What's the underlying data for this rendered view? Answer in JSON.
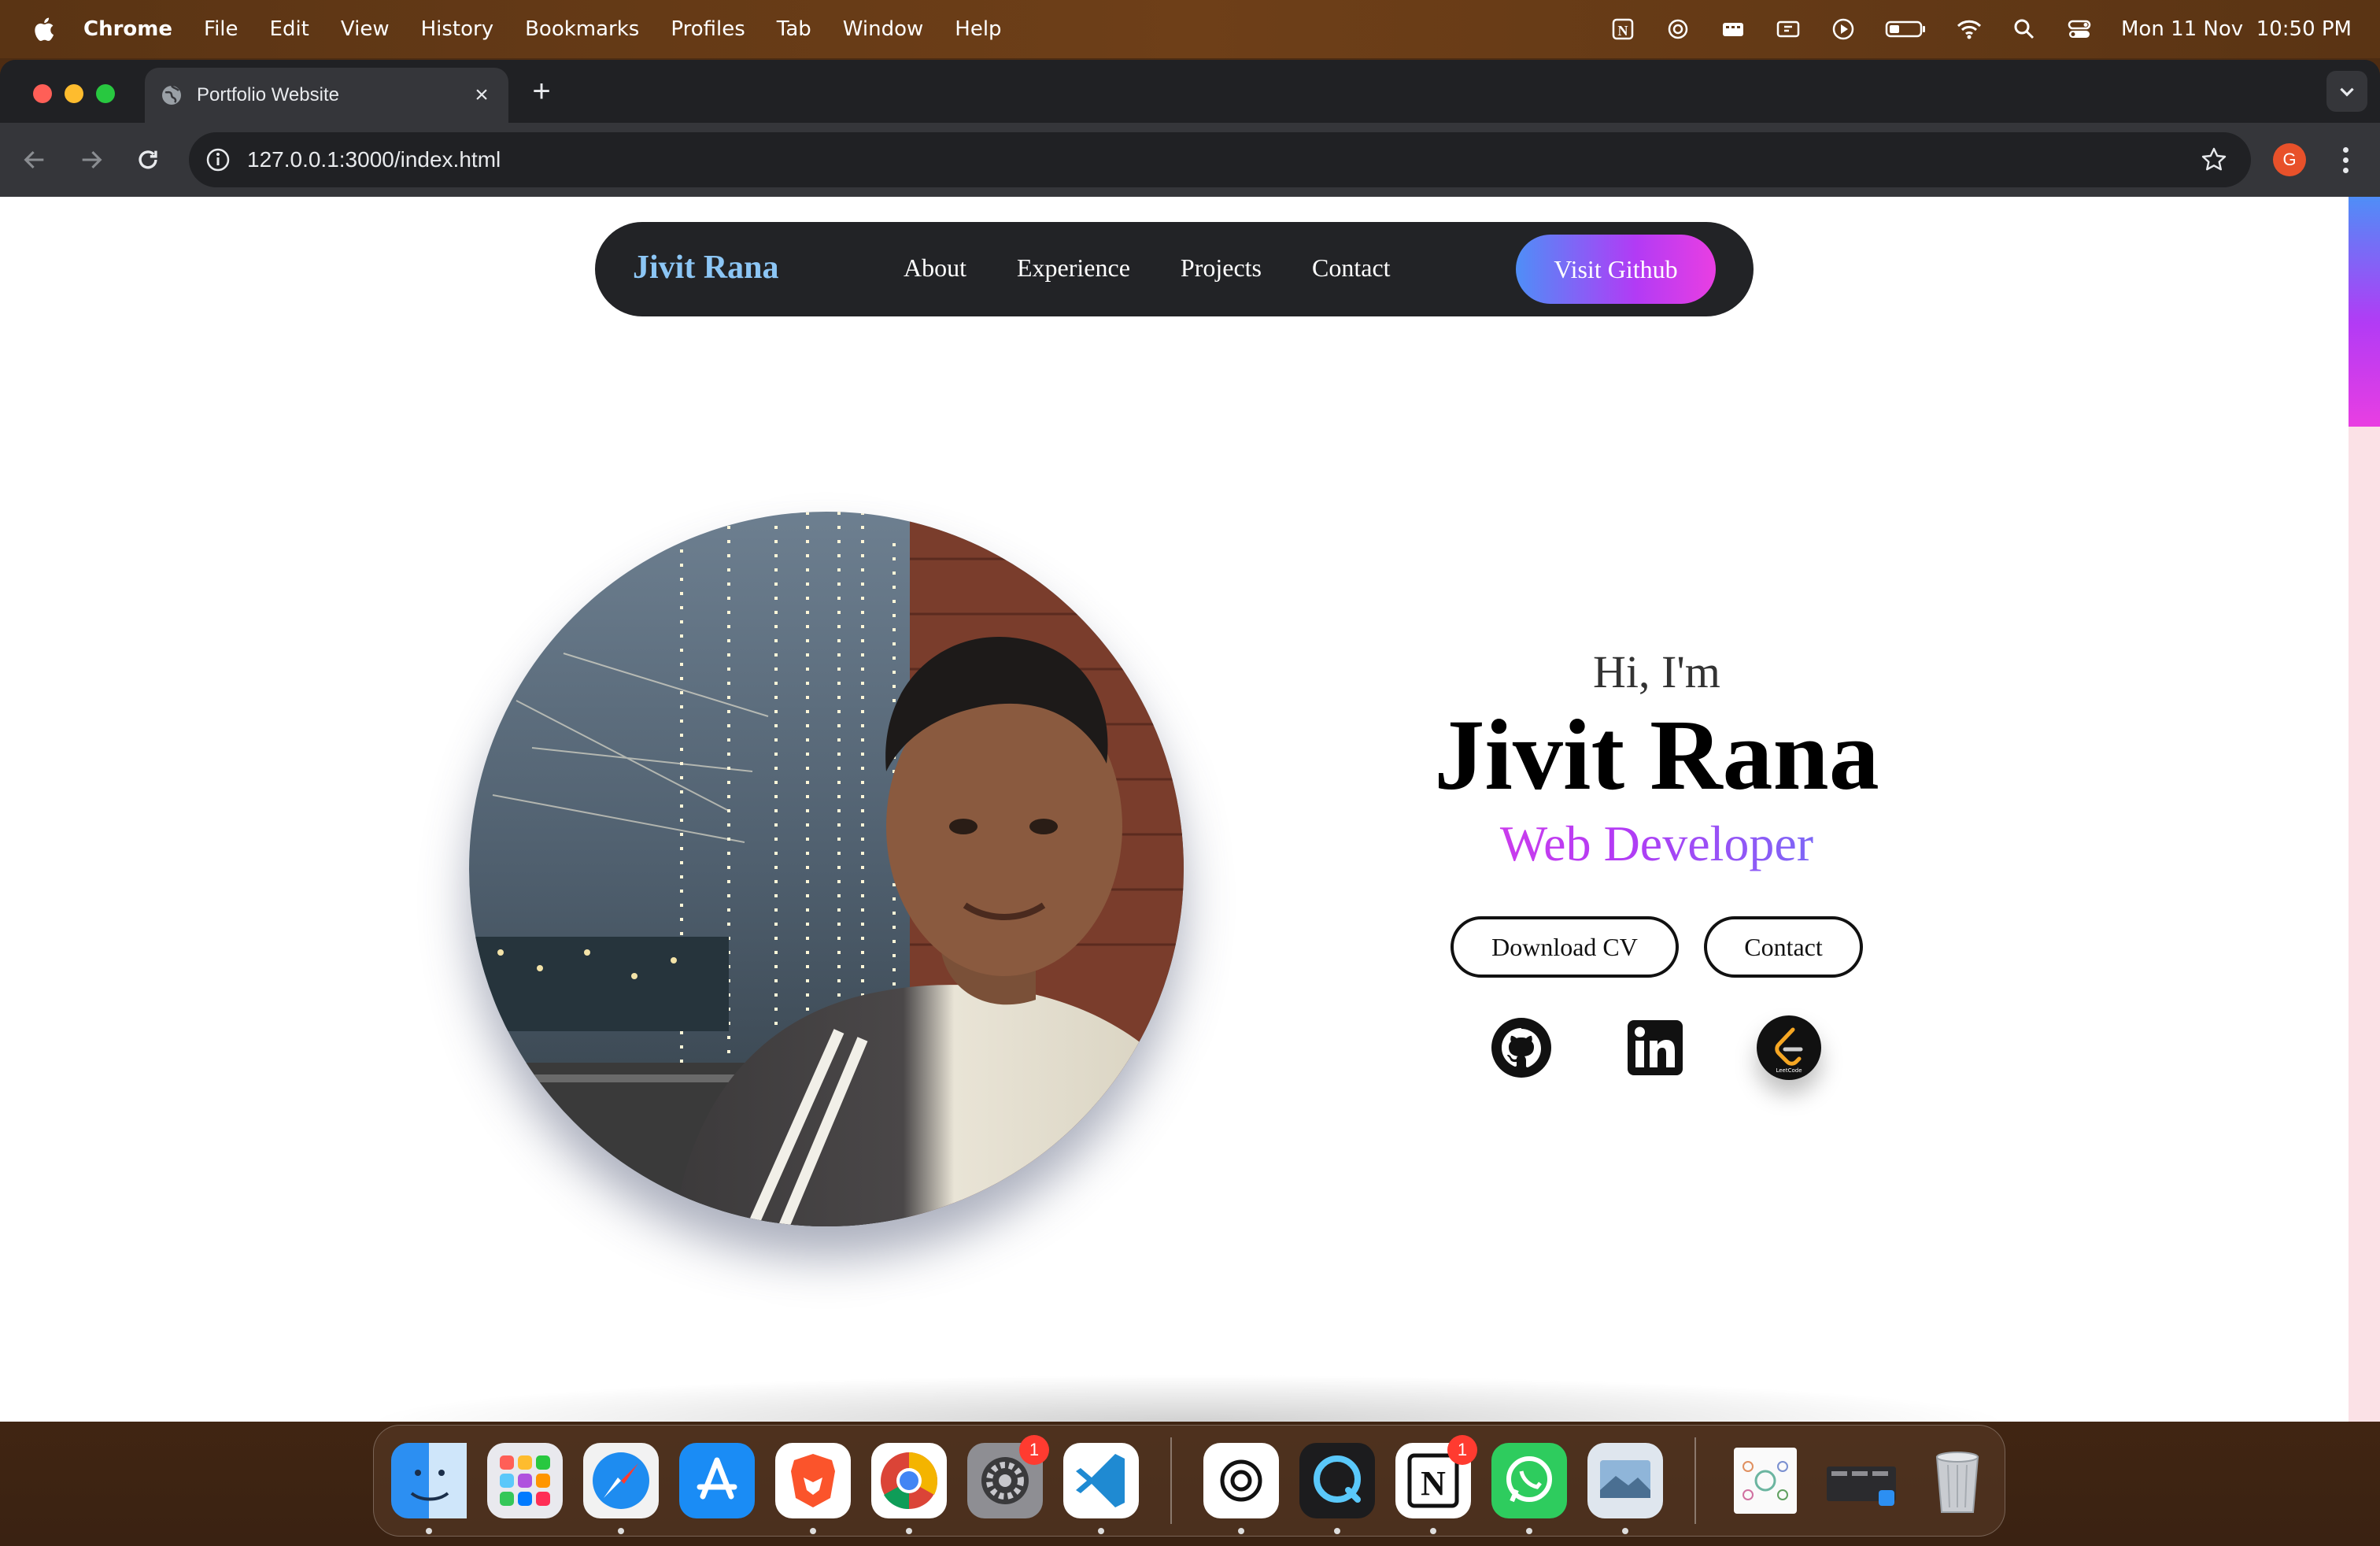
{
  "menubar": {
    "app_name": "Chrome",
    "menus": [
      "File",
      "Edit",
      "View",
      "History",
      "Bookmarks",
      "Profiles",
      "Tab",
      "Window",
      "Help"
    ],
    "clock": "Mon 11 Nov  10:50 PM",
    "status_icons": [
      "notion-icon",
      "chatgpt-icon",
      "menu-extra-icon",
      "display-icon",
      "play-icon",
      "battery-icon",
      "wifi-icon",
      "search-icon",
      "control-center-icon"
    ]
  },
  "browser": {
    "tab_title": "Portfolio Website",
    "url": "127.0.0.1:3000/index.html",
    "profile_initial": "G"
  },
  "site": {
    "brand": "Jivit Rana",
    "nav_links": [
      "About",
      "Experience",
      "Projects",
      "Contact"
    ],
    "github_button": "Visit Github",
    "greeting": "Hi, I'm",
    "name": "Jivit Rana",
    "role": "Web Developer",
    "download_cv": "Download CV",
    "contact": "Contact",
    "socials": [
      "github-icon",
      "linkedin-icon",
      "leetcode-icon"
    ],
    "leetcode_caption": "LeetCode"
  },
  "dock": {
    "apps": [
      "Finder",
      "Launchpad",
      "Safari",
      "App Store",
      "Brave",
      "Chrome",
      "System Settings",
      "VS Code",
      "ChatGPT",
      "QuickTime",
      "Notion",
      "WhatsApp",
      "Preview"
    ],
    "badges": {
      "system_settings": "1",
      "notion": "1"
    }
  },
  "colors": {
    "accent_blue": "#4f8ef7",
    "accent_purple": "#b23bf5",
    "accent_pink": "#e93ee2",
    "brand_blue": "#8cc6f5",
    "nav_bg": "#222326"
  }
}
